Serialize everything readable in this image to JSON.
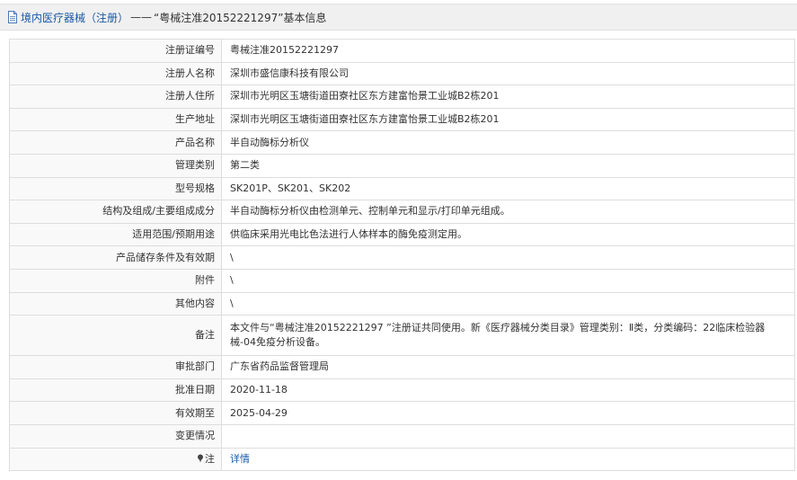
{
  "header": {
    "category_link": "境内医疗器械（注册）",
    "separator": "——",
    "title_rest": "“粤械注准20152221297”基本信息"
  },
  "rows": [
    {
      "label": "注册证编号",
      "value": "粤械注准20152221297"
    },
    {
      "label": "注册人名称",
      "value": "深圳市盛信康科技有限公司"
    },
    {
      "label": "注册人住所",
      "value": "深圳市光明区玉塘街道田寮社区东方建富怡景工业城B2栋201"
    },
    {
      "label": "生产地址",
      "value": "深圳市光明区玉塘街道田寮社区东方建富怡景工业城B2栋201"
    },
    {
      "label": "产品名称",
      "value": "半自动酶标分析仪"
    },
    {
      "label": "管理类别",
      "value": "第二类"
    },
    {
      "label": "型号规格",
      "value": "SK201P、SK201、SK202"
    },
    {
      "label": "结构及组成/主要组成成分",
      "value": "半自动酶标分析仪由检测单元、控制单元和显示/打印单元组成。"
    },
    {
      "label": "适用范围/预期用途",
      "value": "供临床采用光电比色法进行人体样本的酶免疫测定用。"
    },
    {
      "label": "产品储存条件及有效期",
      "value": "\\"
    },
    {
      "label": "附件",
      "value": "\\"
    },
    {
      "label": "其他内容",
      "value": "\\"
    },
    {
      "label": "备注",
      "value": "本文件与“粤械注准20152221297 ”注册证共同使用。新《医疗器械分类目录》管理类别：Ⅱ类，分类编码：22临床检验器械-04免疫分析设备。"
    },
    {
      "label": "审批部门",
      "value": "广东省药品监督管理局"
    },
    {
      "label": "批准日期",
      "value": "2020-11-18"
    },
    {
      "label": "有效期至",
      "value": "2025-04-29"
    },
    {
      "label": "变更情况",
      "value": ""
    }
  ],
  "note": {
    "label": "注",
    "link": "详情"
  }
}
